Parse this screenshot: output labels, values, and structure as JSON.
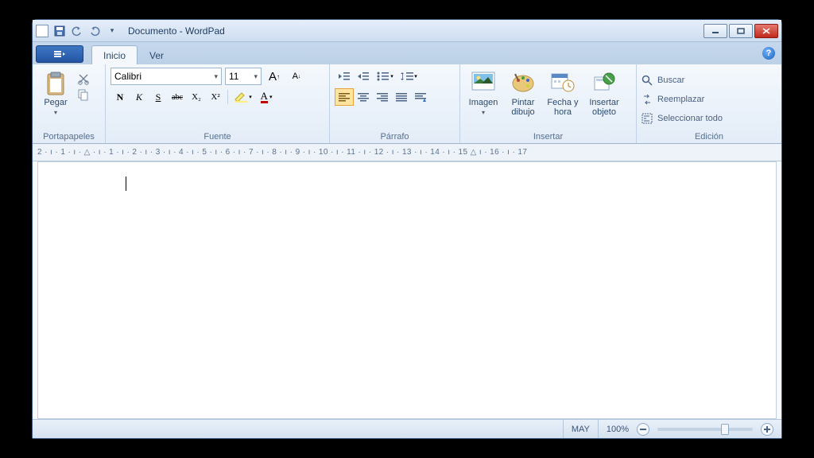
{
  "title": "Documento - WordPad",
  "tabs": {
    "inicio": "Inicio",
    "ver": "Ver"
  },
  "groups": {
    "clipboard": "Portapapeles",
    "font": "Fuente",
    "paragraph": "Párrafo",
    "insert": "Insertar",
    "edit": "Edición"
  },
  "clipboard": {
    "paste": "Pegar"
  },
  "font": {
    "family": "Calibri",
    "size": "11",
    "bold": "N",
    "italic": "K",
    "underline": "S",
    "strike": "abc",
    "subscript": "X₂",
    "superscript": "X²",
    "grow": "A",
    "shrink": "A"
  },
  "insert": {
    "image": "Imagen",
    "paint": "Pintar dibujo",
    "datetime": "Fecha y hora",
    "object": "Insertar objeto"
  },
  "edit": {
    "find": "Buscar",
    "replace": "Reemplazar",
    "selectall": "Seleccionar todo"
  },
  "ruler": "2 · ı · 1 · ı · △ · ı · 1 · ı · 2 · ı · 3 · ı · 4 · ı · 5 · ı · 6 · ı · 7 · ı · 8 · ı · 9 · ı · 10 · ı · 11 · ı · 12 · ı · 13 · ı · 14 · ı · 15 △ ı · 16 · ı · 17",
  "status": {
    "caps": "MAY",
    "zoom": "100%"
  }
}
